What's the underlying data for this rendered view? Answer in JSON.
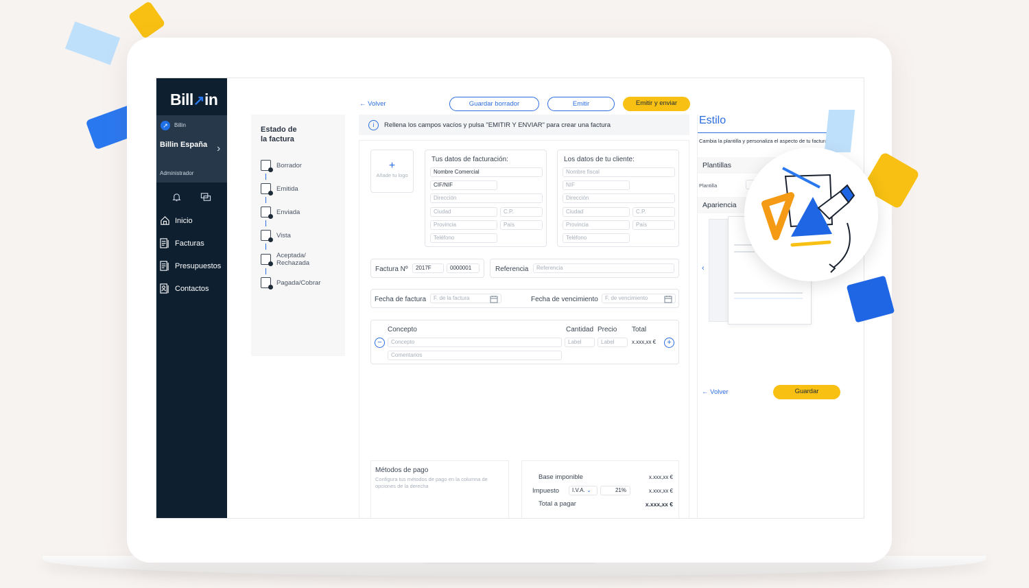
{
  "sidebar": {
    "logo": "Bill",
    "logo_suffix": "in",
    "brand_small": "Billin",
    "company": "Billin España",
    "role": "Administrador",
    "items": [
      {
        "label": "Inicio",
        "icon": "home-icon"
      },
      {
        "label": "Facturas",
        "icon": "invoice-icon"
      },
      {
        "label": "Presupuestos",
        "icon": "quote-icon"
      },
      {
        "label": "Contactos",
        "icon": "contacts-icon"
      }
    ]
  },
  "status": {
    "title_line1": "Estado de",
    "title_line2": "la factura",
    "steps": [
      "Borrador",
      "Emitida",
      "Enviada",
      "Vista",
      "Aceptada/\nRechazada",
      "Pagada/Cobrar"
    ]
  },
  "toolbar": {
    "back": "← Volver",
    "save_draft": "Guardar borrador",
    "emit": "Emitir",
    "emit_send": "Emitir y enviar"
  },
  "info": {
    "text": "Rellena los campos vacíos y pulsa \"EMITIR Y ENVIAR\" para crear una factura"
  },
  "logo_box": {
    "plus": "+",
    "label": "Añade tu logo"
  },
  "billing": {
    "title": "Tus datos de facturación:",
    "commercial": "Nombre Comercial",
    "cif": "CIF/NIF",
    "address": "Dirección",
    "city": "Ciudad",
    "cp": "C.P.",
    "province": "Provincia",
    "country": "País",
    "phone": "Teléfono"
  },
  "client": {
    "title": "Los datos de tu cliente:",
    "fiscal": "Nombre fiscal",
    "nif": "NIF",
    "address": "Dirección",
    "city": "Ciudad",
    "cp": "C.P.",
    "province": "Provincia",
    "country": "País",
    "phone": "Teléfono"
  },
  "invoice": {
    "number_label": "Factura Nº",
    "series": "2017F",
    "number": "0000001",
    "ref_label": "Referencia",
    "ref_placeholder": "Referencia",
    "date_label": "Fecha de factura",
    "date_placeholder": "F. de la factura",
    "due_label": "Fecha de vencimiento",
    "due_placeholder": "F. de vencimiento"
  },
  "lines": {
    "concept_h": "Concepto",
    "qty_h": "Cantidad",
    "price_h": "Precio",
    "total_h": "Total",
    "concept_ph": "Concepto",
    "qty_ph": "Label",
    "price_ph": "Label",
    "total": "x.xxx,xx €",
    "comments_ph": "Comentarios",
    "remove": "−",
    "add": "+"
  },
  "payment": {
    "title": "Métodos de pago",
    "desc": "Configura tus métodos de pago en la columna de opciones de la derecha"
  },
  "totals": {
    "base_label": "Base imponible",
    "base": "x.xxx,xx €",
    "tax_label": "Impuesto",
    "tax_type": "I.V.A.",
    "tax_rate": "21%",
    "tax": "x.xxx,xx €",
    "total_label": "Total a pagar",
    "total": "x.xxx,xx €"
  },
  "style": {
    "title": "Estilo",
    "desc": "Cambia la plantilla y personaliza el aspecto de tu factura",
    "templates": "Plantillas",
    "template_label": "Plantilla",
    "appearance": "Apariencia",
    "back": "← Volver",
    "save": "Guardar"
  },
  "colors": {
    "navy": "#0e1f30",
    "blue": "#2a6de0",
    "yellow": "#f8c012"
  }
}
